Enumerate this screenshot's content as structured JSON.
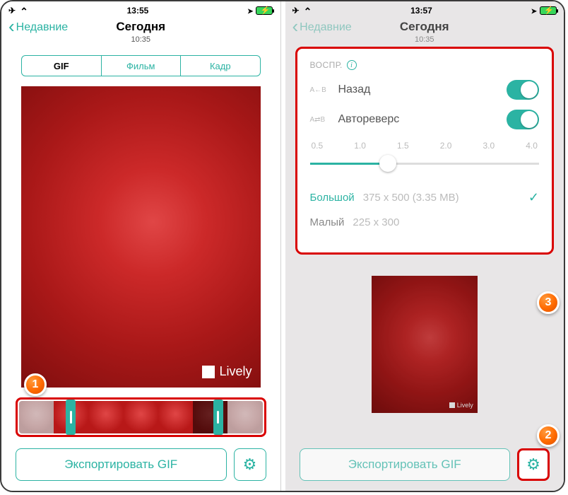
{
  "left": {
    "status": {
      "time": "13:55"
    },
    "header": {
      "back": "Недавние",
      "title": "Сегодня",
      "sub": "10:35"
    },
    "seg": {
      "gif": "GIF",
      "film": "Фильм",
      "frame": "Кадр"
    },
    "watermark": "Lively",
    "export": "Экспортировать GIF",
    "badge1": "1"
  },
  "right": {
    "status": {
      "time": "13:57"
    },
    "header": {
      "back": "Недавние",
      "title": "Сегодня",
      "sub": "10:35"
    },
    "panel": {
      "playback_label": "ВОСПР.",
      "back_opt": "Назад",
      "autoreverse_opt": "Автореверс",
      "scale": [
        "0.5",
        "1.0",
        "1.5",
        "2.0",
        "3.0",
        "4.0"
      ],
      "big_label": "Большой",
      "big_dims": "375 x 500 (3.35 MB)",
      "small_label": "Малый",
      "small_dims": "225 x 300"
    },
    "watermark": "Lively",
    "export": "Экспортировать GIF",
    "badge2": "2",
    "badge3": "3"
  }
}
